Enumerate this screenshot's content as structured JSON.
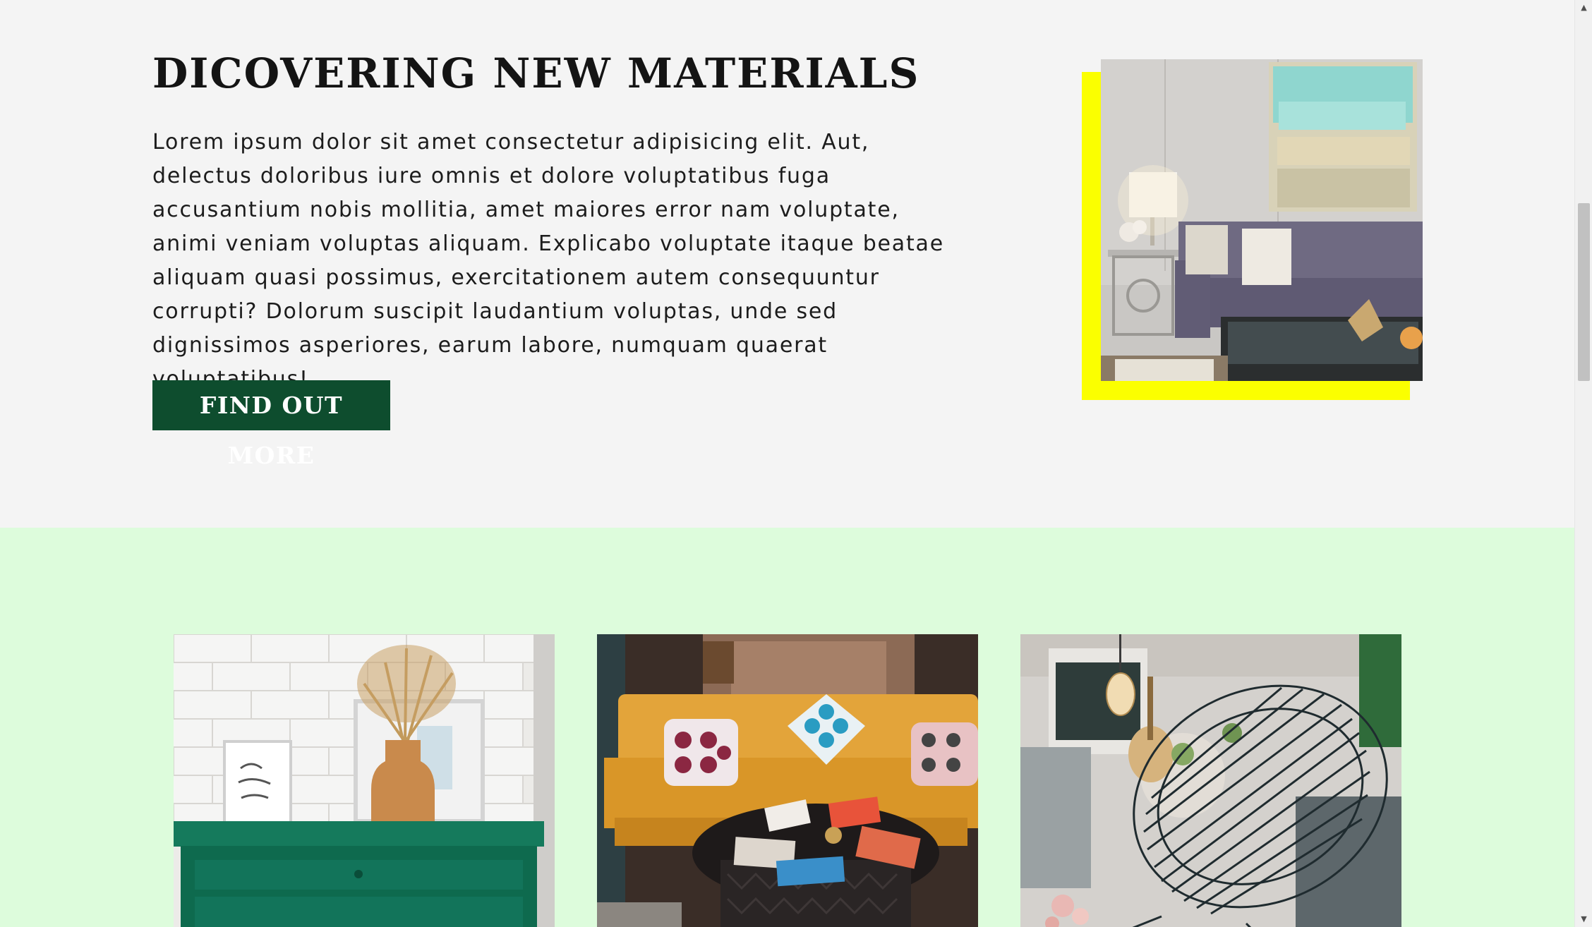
{
  "hero": {
    "title": "DICOVERING NEW MATERIALS",
    "body": "Lorem ipsum dolor sit amet consectetur adipisicing elit. Aut, delectus doloribus iure omnis et dolore voluptatibus fuga accusantium nobis mollitia, amet maiores error nam voluptate, animi veniam voluptas aliquam. Explicabo voluptate itaque beatae aliquam quasi possimus, exercitationem autem consequuntur corrupti? Dolorum suscipit laudantium voluptas, unde sed dignissimos asperiores, earum labore, numquam quaerat voluptatibus!",
    "cta_label": "FIND OUT MORE"
  },
  "scrollbar": {
    "up_arrow": "▲",
    "down_arrow": "▼"
  },
  "colors": {
    "background": "#f4f4f4",
    "accent_yellow": "#fbff00",
    "button_green": "#0e4d2e",
    "gallery_mint": "#ddfcdc"
  }
}
